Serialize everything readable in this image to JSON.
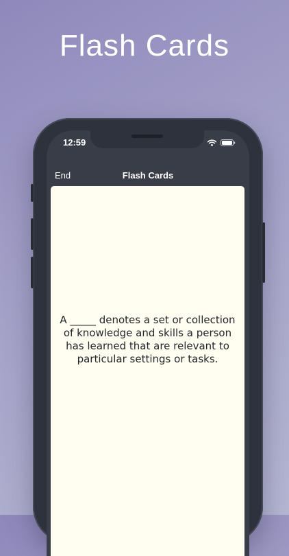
{
  "promo": {
    "title": "Flash Cards"
  },
  "status_bar": {
    "time": "12:59",
    "icons": [
      "wifi-icon",
      "battery-icon"
    ]
  },
  "navbar": {
    "end_label": "End",
    "title": "Flash Cards"
  },
  "card": {
    "text": "A _____ denotes a set or collection of knowledge and skills a person has learned that are relevant to particular settings or tasks."
  },
  "colors": {
    "background_start": "#8f89bb",
    "background_end": "#b5b7d2",
    "device_frame": "#2d323c",
    "navbar_bg": "#383d47",
    "card_bg": "#fffef0",
    "card_text": "#23262c",
    "nav_text": "#ffffff"
  }
}
